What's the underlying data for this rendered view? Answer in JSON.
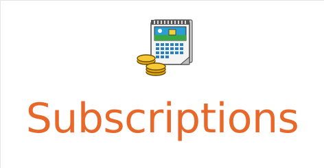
{
  "tile": {
    "label": "Subscriptions",
    "icon": "calendar-and-coins-icon",
    "label_color": "#e8682a"
  }
}
